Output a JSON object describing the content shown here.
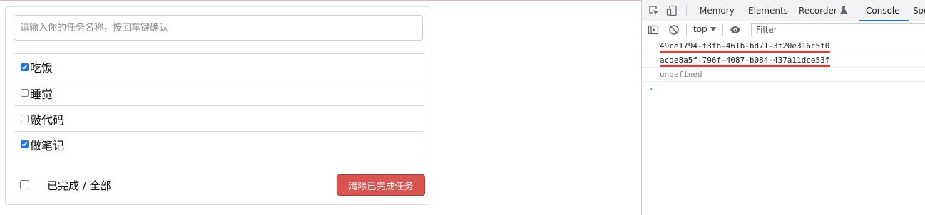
{
  "todo": {
    "input_placeholder": "请输入你的任务名称，按回车键确认",
    "items": [
      {
        "label": "吃饭",
        "done": true
      },
      {
        "label": "睡觉",
        "done": false
      },
      {
        "label": "敲代码",
        "done": false
      },
      {
        "label": "做笔记",
        "done": true
      }
    ],
    "footer": {
      "summary_label": "已完成 / 全部",
      "clear_button": "清除已完成任务"
    }
  },
  "devtools": {
    "tabs": [
      "Memory",
      "Elements",
      "Recorder",
      "Console",
      "Sou"
    ],
    "active_tab": "Console",
    "toolbar": {
      "context": "top",
      "filter_placeholder": "Filter"
    },
    "console_lines": [
      "49ce1794-f3fb-461b-bd71-3f20e316c5f0",
      "acde8a5f-796f-4087-b084-437a11dce53f",
      "undefined"
    ],
    "prompt": "›"
  },
  "colors": {
    "danger": "#d9534f",
    "accent": "#1a73e8",
    "highlight": "#e53935"
  },
  "icons": [
    "inspect-element-icon",
    "device-toggle-icon",
    "flask-icon",
    "sidebar-toggle-icon",
    "clear-console-icon",
    "dropdown-caret-icon",
    "eye-icon"
  ]
}
